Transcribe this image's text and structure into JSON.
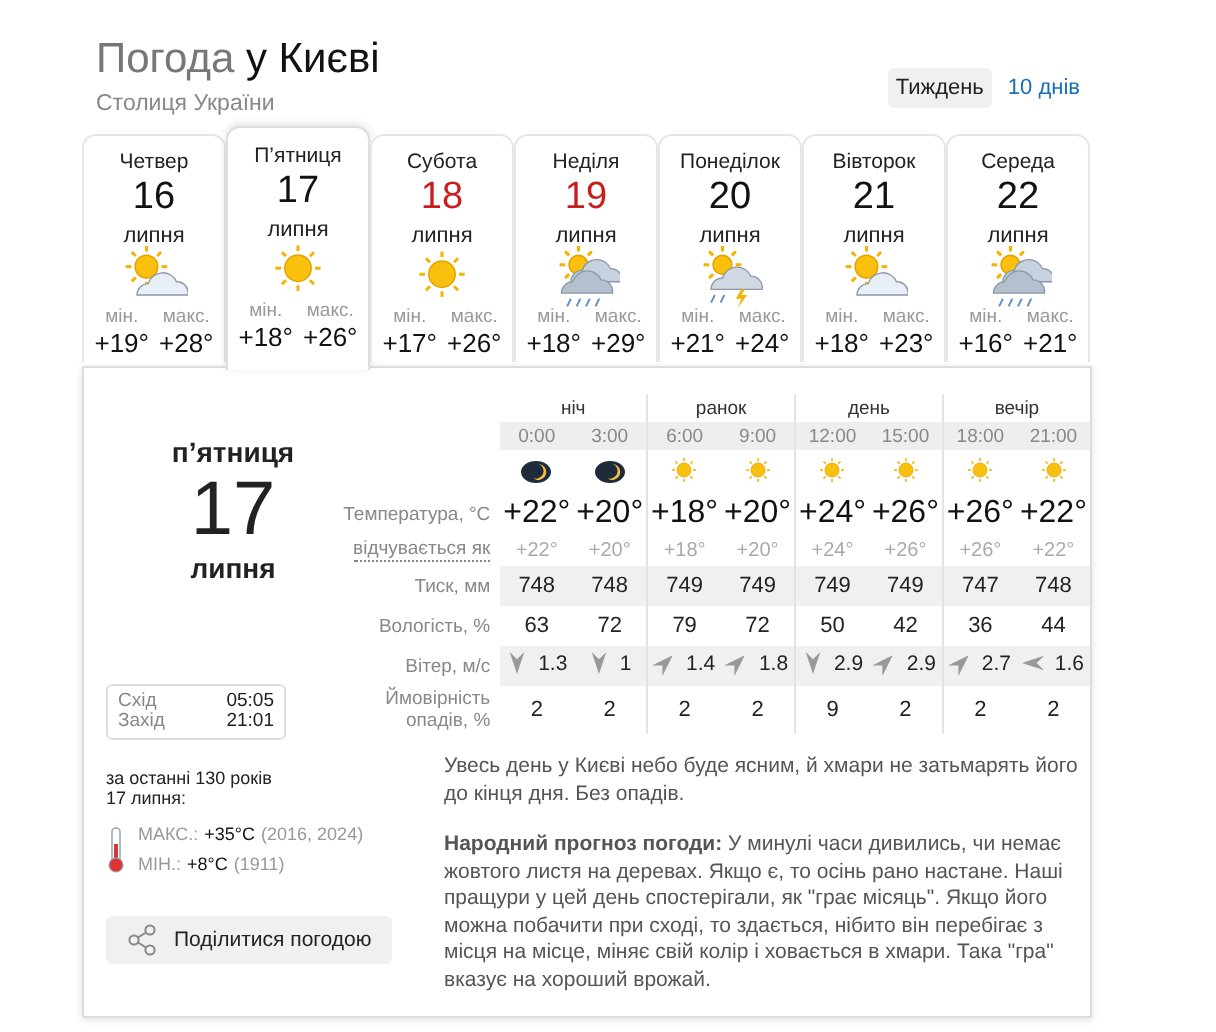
{
  "header": {
    "title_prefix": "Погода",
    "title_city": "у Києві",
    "subtitle": "Столиця України"
  },
  "view_tabs": [
    {
      "label": "Тиждень",
      "selected": true
    },
    {
      "label": "10 днів",
      "selected": false
    }
  ],
  "days": [
    {
      "name": "Четвер",
      "date": "16",
      "month": "липня",
      "weekend": false,
      "selected": false,
      "kind": "sun-cloud",
      "min_label": "мін.",
      "min": "+19°",
      "max_label": "макс.",
      "max": "+28°"
    },
    {
      "name": "П’ятниця",
      "date": "17",
      "month": "липня",
      "weekend": false,
      "selected": true,
      "kind": "sun",
      "min_label": "мін.",
      "min": "+18°",
      "max_label": "макс.",
      "max": "+26°"
    },
    {
      "name": "Субота",
      "date": "18",
      "month": "липня",
      "weekend": true,
      "selected": false,
      "kind": "sun",
      "min_label": "мін.",
      "min": "+17°",
      "max_label": "макс.",
      "max": "+26°"
    },
    {
      "name": "Неділя",
      "date": "19",
      "month": "липня",
      "weekend": true,
      "selected": false,
      "kind": "sun-cloud-rain",
      "min_label": "мін.",
      "min": "+18°",
      "max_label": "макс.",
      "max": "+29°"
    },
    {
      "name": "Понеділок",
      "date": "20",
      "month": "липня",
      "weekend": false,
      "selected": false,
      "kind": "sun-cloud-storm",
      "min_label": "мін.",
      "min": "+21°",
      "max_label": "макс.",
      "max": "+24°"
    },
    {
      "name": "Вівторок",
      "date": "21",
      "month": "липня",
      "weekend": false,
      "selected": false,
      "kind": "sun-cloud",
      "min_label": "мін.",
      "min": "+18°",
      "max_label": "макс.",
      "max": "+23°"
    },
    {
      "name": "Середа",
      "date": "22",
      "month": "липня",
      "weekend": false,
      "selected": false,
      "kind": "sun-cloud-rain",
      "min_label": "мін.",
      "min": "+16°",
      "max_label": "макс.",
      "max": "+21°"
    }
  ],
  "detail": {
    "weekday": "п’ятниця",
    "date": "17",
    "month": "липня",
    "sun": [
      {
        "label": "Схід",
        "time": "05:05"
      },
      {
        "label": "Захід",
        "time": "21:01"
      }
    ],
    "history": {
      "title": "за останні 130 років",
      "date": "17 липня:",
      "max_label": "МАКС.:",
      "max": "+35°C",
      "max_years": "(2016, 2024)",
      "min_label": "МІН.:",
      "min": "+8°C",
      "min_years": "(1911)"
    },
    "share_button": "Поділитися погодою",
    "row_labels": [
      "Температура, °C",
      "відчувається як",
      "Тиск, мм",
      "Вологість, %",
      "Вітер, м/с",
      "Ймовірність опадів, %"
    ],
    "periods": [
      "ніч",
      "ранок",
      "день",
      "вечір"
    ],
    "hours": [
      {
        "time": "0:00",
        "kind": "moon",
        "temp": "+22°",
        "feels": "+22°",
        "pressure": "748",
        "humidity": "63",
        "wind": {
          "speed": "1.3",
          "kind": "n"
        },
        "precip": "2"
      },
      {
        "time": "3:00",
        "kind": "moon",
        "temp": "+20°",
        "feels": "+20°",
        "pressure": "748",
        "humidity": "72",
        "wind": {
          "speed": "1",
          "kind": "n"
        },
        "precip": "2"
      },
      {
        "time": "6:00",
        "kind": "sun",
        "temp": "+18°",
        "feels": "+18°",
        "pressure": "749",
        "humidity": "79",
        "wind": {
          "speed": "1.4",
          "kind": "sw"
        },
        "precip": "2"
      },
      {
        "time": "9:00",
        "kind": "sun",
        "temp": "+20°",
        "feels": "+20°",
        "pressure": "749",
        "humidity": "72",
        "wind": {
          "speed": "1.8",
          "kind": "sw"
        },
        "precip": "2"
      },
      {
        "time": "12:00",
        "kind": "sun",
        "temp": "+24°",
        "feels": "+24°",
        "pressure": "749",
        "humidity": "50",
        "wind": {
          "speed": "2.9",
          "kind": "n"
        },
        "precip": "9"
      },
      {
        "time": "15:00",
        "kind": "sun",
        "temp": "+26°",
        "feels": "+26°",
        "pressure": "749",
        "humidity": "42",
        "wind": {
          "speed": "2.9",
          "kind": "sw"
        },
        "precip": "2"
      },
      {
        "time": "18:00",
        "kind": "sun",
        "temp": "+26°",
        "feels": "+26°",
        "pressure": "747",
        "humidity": "36",
        "wind": {
          "speed": "2.7",
          "kind": "sw"
        },
        "precip": "2"
      },
      {
        "time": "21:00",
        "kind": "sun",
        "temp": "+22°",
        "feels": "+22°",
        "pressure": "748",
        "humidity": "44",
        "wind": {
          "speed": "1.6",
          "kind": "e"
        },
        "precip": "2"
      }
    ],
    "summary": "Увесь день у Києві небо буде ясним, й хмари не затьмарять його до кінця дня. Без опадів.",
    "folk": "**Народний прогноз погоди:** У минулі часи дивились, чи немає жовтого листя на деревах. Якщо є, то осінь рано настане. Наші пращури у цей день спостерігали, як \"грає місяць\". Якщо його можна побачити при сході, то здається, нібито він перебігає з місця на місце, міняє свій колір і ховається в хмари. Така \"гра\" вказує на хороший врожай."
  }
}
